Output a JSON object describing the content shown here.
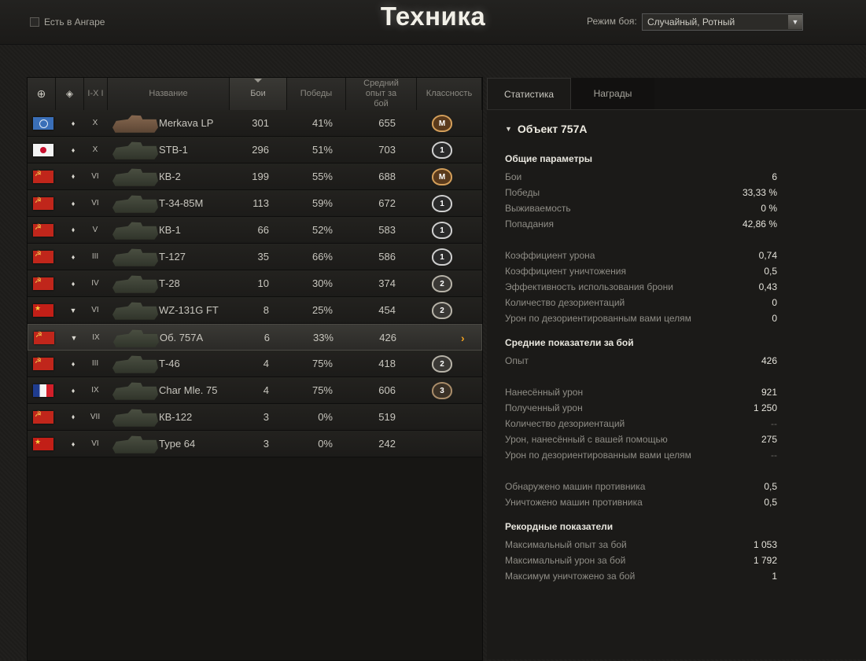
{
  "header": {
    "title": "Техника",
    "in_hangar_label": "Есть в Ангаре",
    "mode_label": "Режим боя:",
    "mode_value": "Случайный, Ротный"
  },
  "table": {
    "columns": [
      "",
      "",
      "I-X I",
      "Название",
      "Бои",
      "Победы",
      "Средний опыт за бой",
      "Классность"
    ],
    "rows": [
      {
        "flag": "intl",
        "type": "light",
        "tier": "X",
        "name": "Merkava LP",
        "battles": "301",
        "wins": "41%",
        "xp": "655",
        "badge": "M"
      },
      {
        "flag": "japan",
        "type": "light",
        "tier": "X",
        "name": "STB-1",
        "battles": "296",
        "wins": "51%",
        "xp": "703",
        "badge": "1"
      },
      {
        "flag": "ussr",
        "type": "heavy",
        "tier": "VI",
        "name": "КВ-2",
        "battles": "199",
        "wins": "55%",
        "xp": "688",
        "badge": "M"
      },
      {
        "flag": "ussr",
        "type": "light",
        "tier": "VI",
        "name": "Т-34-85М",
        "battles": "113",
        "wins": "59%",
        "xp": "672",
        "badge": "1"
      },
      {
        "flag": "ussr",
        "type": "heavy",
        "tier": "V",
        "name": "КВ-1",
        "battles": "66",
        "wins": "52%",
        "xp": "583",
        "badge": "1"
      },
      {
        "flag": "ussr",
        "type": "light",
        "tier": "III",
        "name": "Т-127",
        "battles": "35",
        "wins": "66%",
        "xp": "586",
        "badge": "1"
      },
      {
        "flag": "ussr",
        "type": "light",
        "tier": "IV",
        "name": "Т-28",
        "battles": "10",
        "wins": "30%",
        "xp": "374",
        "badge": "2"
      },
      {
        "flag": "china",
        "type": "td",
        "tier": "VI",
        "name": "WZ-131G FT",
        "battles": "8",
        "wins": "25%",
        "xp": "454",
        "badge": "2"
      },
      {
        "flag": "ussr",
        "type": "td",
        "tier": "IX",
        "name": "Об. 757А",
        "battles": "6",
        "wins": "33%",
        "xp": "426",
        "badge": ""
      },
      {
        "flag": "ussr",
        "type": "light",
        "tier": "III",
        "name": "Т-46",
        "battles": "4",
        "wins": "75%",
        "xp": "418",
        "badge": "2"
      },
      {
        "flag": "france",
        "type": "light",
        "tier": "IX",
        "name": "Char Mle. 75",
        "battles": "4",
        "wins": "75%",
        "xp": "606",
        "badge": "3"
      },
      {
        "flag": "ussr",
        "type": "heavy",
        "tier": "VII",
        "name": "КВ-122",
        "battles": "3",
        "wins": "0%",
        "xp": "519",
        "badge": ""
      },
      {
        "flag": "china",
        "type": "light",
        "tier": "VI",
        "name": "Type 64",
        "battles": "3",
        "wins": "0%",
        "xp": "242",
        "badge": ""
      }
    ]
  },
  "tabs": [
    "Статистика",
    "Награды"
  ],
  "vehicle_title": "Объект 757А",
  "stats": {
    "general": {
      "title": "Общие параметры",
      "items": [
        {
          "label": "Бои",
          "value": "6"
        },
        {
          "label": "Победы",
          "value": "33,33 %"
        },
        {
          "label": "Выживаемость",
          "value": "0 %"
        },
        {
          "label": "Попадания",
          "value": "42,86 %"
        }
      ],
      "items2": [
        {
          "label": "Коэффициент урона",
          "value": "0,74"
        },
        {
          "label": "Коэффициент уничтожения",
          "value": "0,5"
        },
        {
          "label": "Эффективность использования брони",
          "value": "0,43"
        },
        {
          "label": "Количество дезориентаций",
          "value": "0"
        },
        {
          "label": "Урон по дезориентированным вами целям",
          "value": "0"
        }
      ]
    },
    "average": {
      "title": "Средние показатели за бой",
      "items": [
        {
          "label": "Опыт",
          "value": "426"
        }
      ],
      "items2": [
        {
          "label": "Нанесённый урон",
          "value": "921"
        },
        {
          "label": "Полученный урон",
          "value": "1 250"
        },
        {
          "label": "Количество дезориентаций",
          "value": "--"
        },
        {
          "label": "Урон, нанесённый с вашей помощью",
          "value": "275"
        },
        {
          "label": "Урон по дезориентированным вами целям",
          "value": "--"
        }
      ],
      "items3": [
        {
          "label": "Обнаружено машин противника",
          "value": "0,5"
        },
        {
          "label": "Уничтожено машин противника",
          "value": "0,5"
        }
      ]
    },
    "records": {
      "title": "Рекордные показатели",
      "items": [
        {
          "label": "Максимальный опыт за бой",
          "value": "1 053"
        },
        {
          "label": "Максимальный урон за бой",
          "value": "1 792"
        },
        {
          "label": "Максимум уничтожено за бой",
          "value": "1"
        }
      ]
    }
  }
}
